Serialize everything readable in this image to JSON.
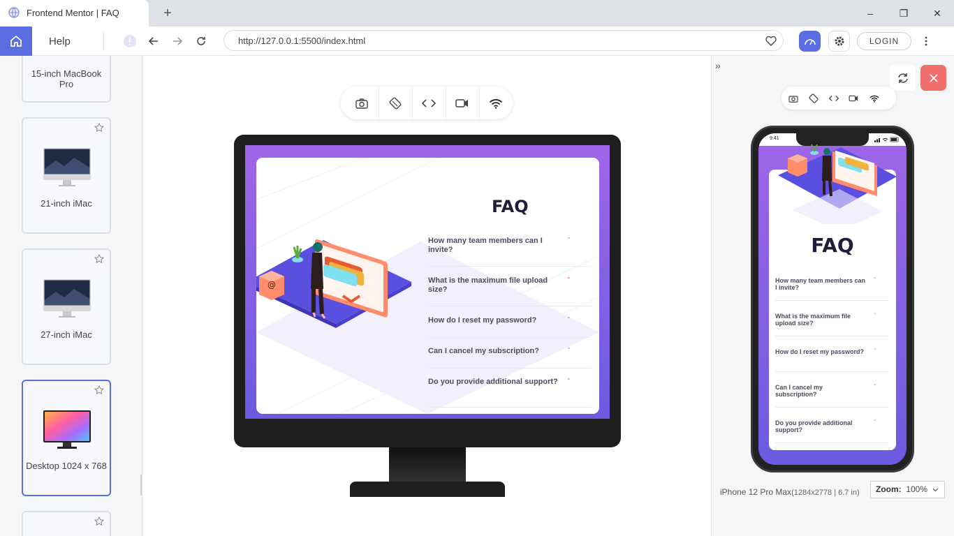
{
  "browser": {
    "tab_title": "Frontend Mentor | FAQ",
    "new_tab": "+",
    "window_controls": {
      "minimize": "–",
      "maximize": "❐",
      "close": "✕"
    }
  },
  "toolbar": {
    "help_label": "Help",
    "url": "http://127.0.0.1:5500/index.html",
    "login_label": "LOGIN"
  },
  "sidebar": {
    "devices": [
      {
        "name": "15-inch MacBook Pro",
        "active": false
      },
      {
        "name": "21-inch iMac",
        "active": false
      },
      {
        "name": "27-inch iMac",
        "active": false
      },
      {
        "name": "Desktop 1024 x 768",
        "active": true
      }
    ]
  },
  "desktop_preview": {
    "faq_title": "FAQ",
    "questions": [
      "How many team members can I invite?",
      "What is the maximum file upload size?",
      "How do I reset my password?",
      "Can I cancel my subscription?",
      "Do you provide additional support?"
    ]
  },
  "mobile_preview": {
    "status_time": "9:41",
    "faq_title": "FAQ",
    "questions": [
      "How many team members can I invite?",
      "What is the maximum file upload size?",
      "How do I reset my password?",
      "Can I cancel my subscription?",
      "Do you provide additional support?"
    ],
    "device_name": "iPhone 12 Pro Max",
    "device_spec": "(1284x2778 | 6.7 in)",
    "zoom_label": "Zoom:",
    "zoom_value": "100%"
  },
  "colors": {
    "accent": "#5b6ee1",
    "close_red": "#f06e6e",
    "faq_gradient_top": "#a066e8",
    "faq_gradient_bottom": "#6b5bdf",
    "faq_heading": "#1e1f36",
    "chevron": "#e06b3b"
  }
}
